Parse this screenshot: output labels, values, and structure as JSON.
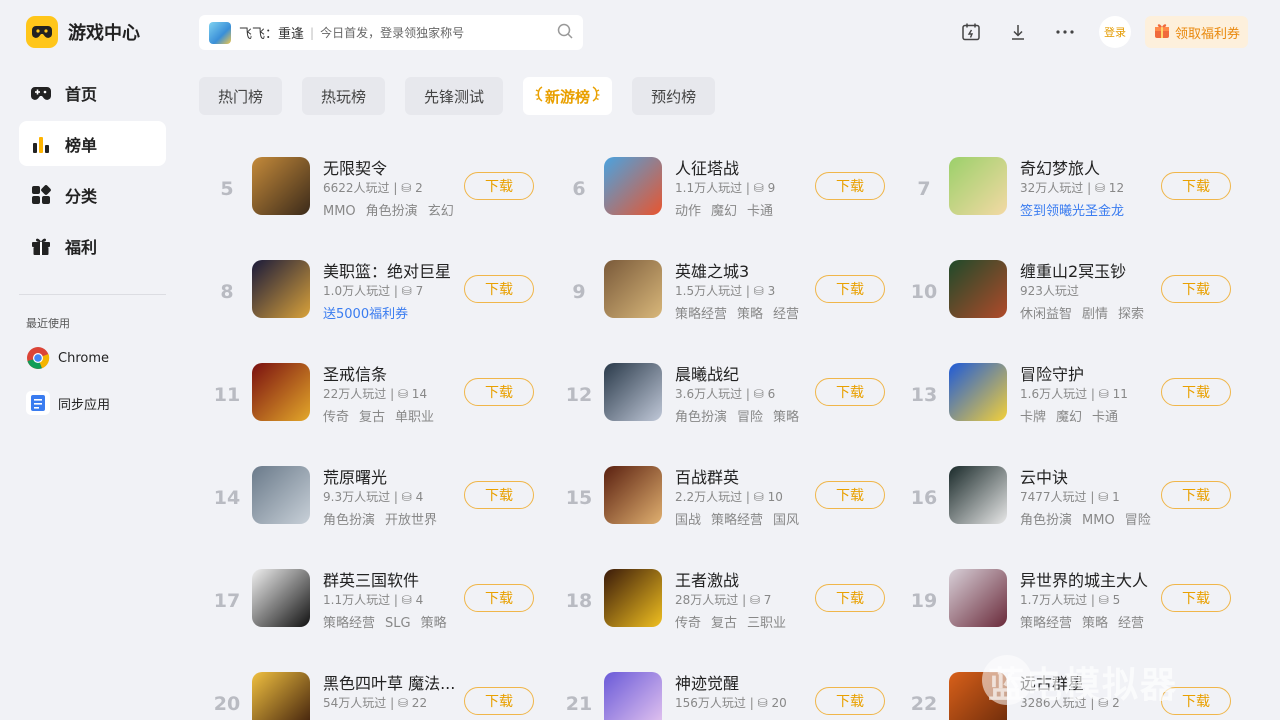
{
  "app": {
    "title": "游戏中心"
  },
  "sidebar": {
    "items": [
      {
        "label": "首页",
        "icon": "gamepad-icon"
      },
      {
        "label": "榜单",
        "icon": "bar-chart-icon"
      },
      {
        "label": "分类",
        "icon": "category-icon"
      },
      {
        "label": "福利",
        "icon": "gift-icon"
      }
    ],
    "recent_title": "最近使用",
    "recent": [
      {
        "label": "Chrome",
        "icon": "chrome-icon"
      },
      {
        "label": "同步应用",
        "icon": "sync-app-icon"
      }
    ]
  },
  "search": {
    "game": "飞飞：重逢",
    "hint": "今日首发，登录领独家称号"
  },
  "header": {
    "login_label": "登录",
    "coupon_label": "领取福利券"
  },
  "tabs": [
    {
      "label": "热门榜"
    },
    {
      "label": "热玩榜"
    },
    {
      "label": "先锋测试"
    },
    {
      "label": "新游榜",
      "active": true
    },
    {
      "label": "预约榜"
    }
  ],
  "download_label": "下载",
  "games": [
    {
      "rank": "5",
      "name": "无限契令",
      "meta": "6622人玩过 | ⛁ 2",
      "tags": [
        "MMO",
        "角色扮演",
        "玄幻"
      ]
    },
    {
      "rank": "6",
      "name": "人征塔战",
      "meta": "1.1万人玩过 | ⛁ 9",
      "tags": [
        "动作",
        "魔幻",
        "卡通"
      ]
    },
    {
      "rank": "7",
      "name": "奇幻梦旅人",
      "meta": "32万人玩过 | ⛁ 12",
      "promo": "签到领曦光圣金龙"
    },
    {
      "rank": "8",
      "name": "美职篮：绝对巨星",
      "meta": "1.0万人玩过 | ⛁ 7",
      "promo": "送5000福利券"
    },
    {
      "rank": "9",
      "name": "英雄之城3",
      "meta": "1.5万人玩过 | ⛁ 3",
      "tags": [
        "策略经营",
        "策略",
        "经营"
      ]
    },
    {
      "rank": "10",
      "name": "缠重山2冥玉钞",
      "meta": "923人玩过",
      "tags": [
        "休闲益智",
        "剧情",
        "探索"
      ]
    },
    {
      "rank": "11",
      "name": "圣戒信条",
      "meta": "22万人玩过 | ⛁ 14",
      "tags": [
        "传奇",
        "复古",
        "单职业"
      ]
    },
    {
      "rank": "12",
      "name": "晨曦战纪",
      "meta": "3.6万人玩过 | ⛁ 6",
      "tags": [
        "角色扮演",
        "冒险",
        "策略"
      ]
    },
    {
      "rank": "13",
      "name": "冒险守护",
      "meta": "1.6万人玩过 | ⛁ 11",
      "tags": [
        "卡牌",
        "魔幻",
        "卡通"
      ]
    },
    {
      "rank": "14",
      "name": "荒原曙光",
      "meta": "9.3万人玩过 | ⛁ 4",
      "tags": [
        "角色扮演",
        "开放世界"
      ]
    },
    {
      "rank": "15",
      "name": "百战群英",
      "meta": "2.2万人玩过 | ⛁ 10",
      "tags": [
        "国战",
        "策略经营",
        "国风"
      ]
    },
    {
      "rank": "16",
      "name": "云中诀",
      "meta": "7477人玩过 | ⛁ 1",
      "tags": [
        "角色扮演",
        "MMO",
        "冒险"
      ]
    },
    {
      "rank": "17",
      "name": "群英三国软件",
      "meta": "1.1万人玩过 | ⛁ 4",
      "tags": [
        "策略经营",
        "SLG",
        "策略"
      ]
    },
    {
      "rank": "18",
      "name": "王者激战",
      "meta": "28万人玩过 | ⛁ 7",
      "tags": [
        "传奇",
        "复古",
        "三职业"
      ]
    },
    {
      "rank": "19",
      "name": "异世界的城主大人",
      "meta": "1.7万人玩过 | ⛁ 5",
      "tags": [
        "策略经营",
        "策略",
        "经营"
      ]
    },
    {
      "rank": "20",
      "name": "黑色四叶草 魔法...",
      "meta": "54万人玩过 | ⛁ 22",
      "promo": ""
    },
    {
      "rank": "21",
      "name": "神迹觉醒",
      "meta": "156万人玩过 | ⛁ 20",
      "promo": ""
    },
    {
      "rank": "22",
      "name": "远古群星",
      "meta": "3286人玩过 | ⛁ 2",
      "tags": []
    }
  ],
  "colors": {
    "accent": "#e9a000",
    "brand": "#ffc61a",
    "promo": "#3a7cf0"
  },
  "watermark": "蓝电模拟器"
}
